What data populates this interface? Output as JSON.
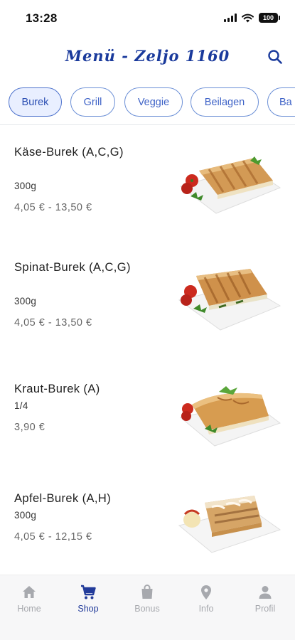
{
  "status_bar": {
    "time": "13:28",
    "battery": "100"
  },
  "header": {
    "title": "Menü - Zeljo 1160"
  },
  "tabs": [
    {
      "label": "Burek",
      "active": true
    },
    {
      "label": "Grill",
      "active": false
    },
    {
      "label": "Veggie",
      "active": false
    },
    {
      "label": "Beilagen",
      "active": false
    },
    {
      "label": "Ba",
      "active": false
    }
  ],
  "menu_items": [
    {
      "name": "Käse-Burek (A,C,G)",
      "size": "300g",
      "price": "4,05 € - 13,50 €"
    },
    {
      "name": "Spinat-Burek (A,C,G)",
      "size": "300g",
      "price": "4,05 € - 13,50 €"
    },
    {
      "name": "Kraut-Burek (A)",
      "size": "1/4",
      "price": "3,90 €"
    },
    {
      "name": "Apfel-Burek (A,H)",
      "size": "300g",
      "price": "4,05 € - 12,15 €"
    }
  ],
  "bottom_nav": [
    {
      "label": "Home",
      "icon": "home-icon",
      "active": false
    },
    {
      "label": "Shop",
      "icon": "cart-icon",
      "active": true
    },
    {
      "label": "Bonus",
      "icon": "bag-icon",
      "active": false
    },
    {
      "label": "Info",
      "icon": "location-pin-icon",
      "active": false
    },
    {
      "label": "Profil",
      "icon": "person-icon",
      "active": false
    }
  ],
  "colors": {
    "accent": "#223b9a",
    "tab_border": "#6b8fd6",
    "inactive_nav": "#a7a9ae"
  }
}
